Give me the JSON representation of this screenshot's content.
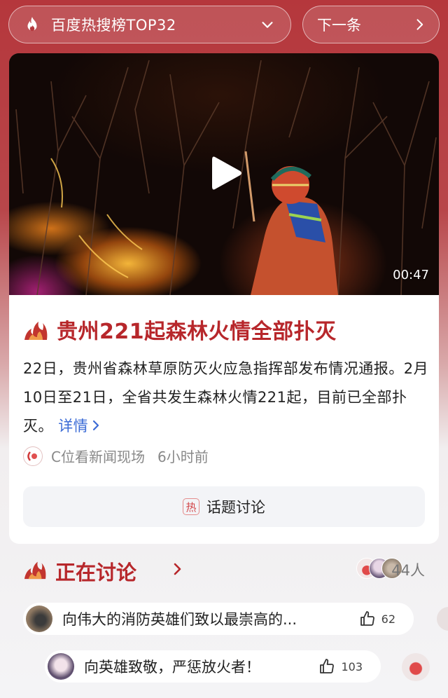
{
  "top_bar": {
    "rank_label": "百度热搜榜TOP32",
    "next_label": "下一条"
  },
  "video": {
    "duration": "00:47"
  },
  "article": {
    "title": "贵州221起森林火情全部扑灭",
    "summary": "22日，贵州省森林草原防灭火应急指挥部发布情况通报。2月10日至21日，全省共发生森林火情221起，目前已全部扑灭。",
    "more_label": "详情",
    "source_name": "C位看新闻现场",
    "time_ago": "6小时前"
  },
  "topic_button": {
    "hot_badge": "热",
    "label": "话题讨论"
  },
  "discussion": {
    "title": "正在讨论",
    "participant_count": "44人",
    "comments": [
      {
        "text": "向伟大的消防英雄们致以最崇高的...",
        "likes": "62"
      },
      {
        "text": "向英雄致敬，严惩放火者！",
        "likes": "103"
      }
    ]
  },
  "colors": {
    "brand_red": "#b7272b",
    "link_blue": "#3b6bd6",
    "muted_gray": "#888888"
  },
  "icons": [
    "flame-icon",
    "chevron-down-icon",
    "chevron-right-icon",
    "play-icon",
    "like-icon"
  ]
}
